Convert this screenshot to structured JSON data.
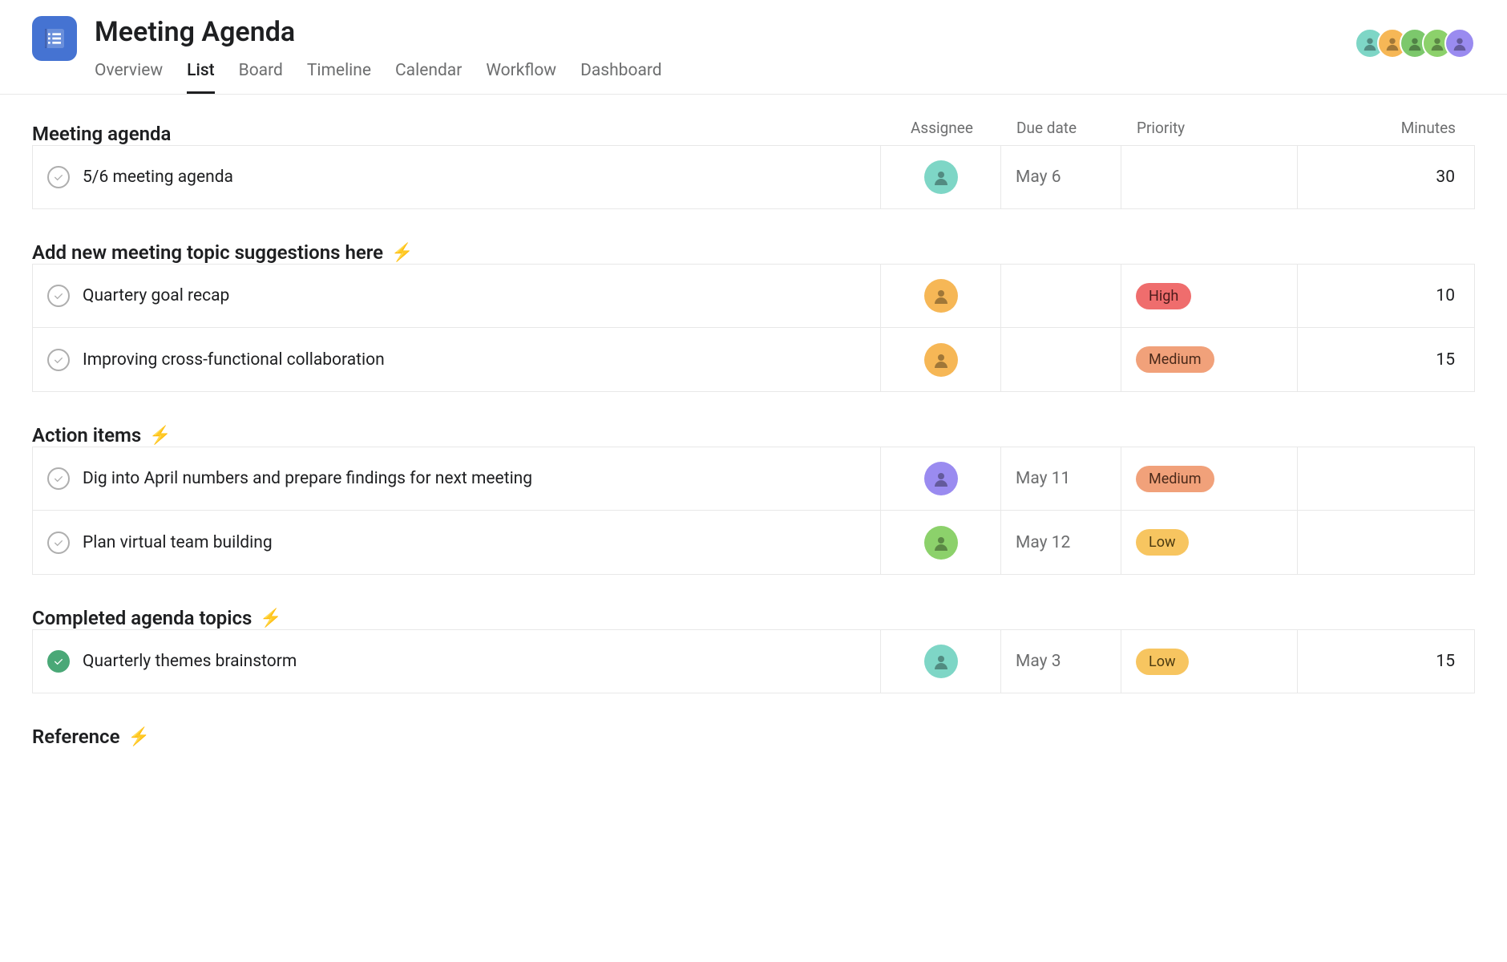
{
  "project": {
    "title": "Meeting Agenda"
  },
  "tabs": [
    "Overview",
    "List",
    "Board",
    "Timeline",
    "Calendar",
    "Workflow",
    "Dashboard"
  ],
  "active_tab": "List",
  "member_colors": [
    "#7ed6c6",
    "#f6b756",
    "#7cc86c",
    "#8cd16b",
    "#9a8bf0"
  ],
  "columns": {
    "assignee": "Assignee",
    "due": "Due date",
    "priority": "Priority",
    "minutes": "Minutes"
  },
  "sections": [
    {
      "title": "Meeting agenda",
      "bolt": false,
      "show_headers": true,
      "tasks": [
        {
          "name": "5/6 meeting agenda",
          "done": false,
          "assignee_color": "#7ed6c6",
          "due": "May 6",
          "priority": "",
          "minutes": "30"
        }
      ]
    },
    {
      "title": "Add new meeting topic suggestions here",
      "bolt": true,
      "show_headers": false,
      "tasks": [
        {
          "name": "Quartery goal recap",
          "done": false,
          "assignee_color": "#f6b756",
          "due": "",
          "priority": "High",
          "minutes": "10"
        },
        {
          "name": "Improving cross-functional collaboration",
          "done": false,
          "assignee_color": "#f6b756",
          "due": "",
          "priority": "Medium",
          "minutes": "15"
        }
      ]
    },
    {
      "title": "Action items",
      "bolt": true,
      "show_headers": false,
      "tasks": [
        {
          "name": "Dig into April numbers and prepare findings for next meeting",
          "done": false,
          "assignee_color": "#9a8bf0",
          "due": "May 11",
          "priority": "Medium",
          "minutes": ""
        },
        {
          "name": "Plan virtual team building",
          "done": false,
          "assignee_color": "#8cd16b",
          "due": "May 12",
          "priority": "Low",
          "minutes": ""
        }
      ]
    },
    {
      "title": "Completed agenda topics",
      "bolt": true,
      "show_headers": false,
      "tasks": [
        {
          "name": "Quarterly themes brainstorm",
          "done": true,
          "assignee_color": "#7ed6c6",
          "due": "May 3",
          "priority": "Low",
          "minutes": "15"
        }
      ]
    },
    {
      "title": "Reference",
      "bolt": true,
      "show_headers": false,
      "tasks": []
    }
  ]
}
